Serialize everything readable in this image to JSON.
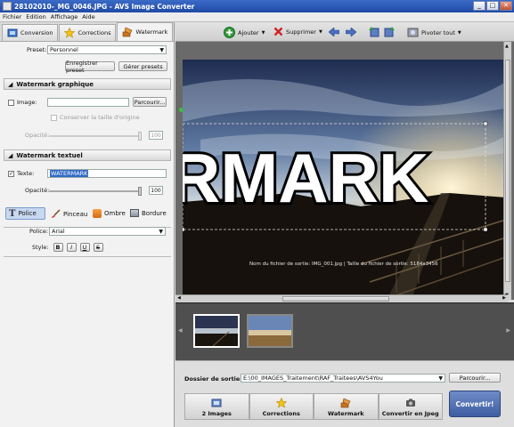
{
  "window": {
    "title": "28102010-_MG_0046.JPG - AVS Image Converter",
    "controls": [
      "_",
      "□",
      "✕"
    ]
  },
  "menu": [
    "Fichier",
    "Edition",
    "Affichage",
    "Aide"
  ],
  "tabs": [
    {
      "label": "Conversion",
      "icon": "conversion-icon"
    },
    {
      "label": "Corrections",
      "icon": "star-icon"
    },
    {
      "label": "Watermark",
      "icon": "watermark-icon",
      "active": true
    }
  ],
  "preset": {
    "label": "Preset:",
    "value": "Personnel"
  },
  "preset_buttons": {
    "save": "Enregistrer preset",
    "manage": "Gérer presets"
  },
  "watermark_graphic": {
    "title": "Watermark graphique",
    "image_label": "Image:",
    "browse": "Parcourir...",
    "keep_size": "Conserver la taille d'origine",
    "opacity_label": "Opacité:",
    "opacity_value": "100",
    "opacity_level": 1.0
  },
  "watermark_text": {
    "title": "Watermark textuel",
    "text_label": "Texte:",
    "text_value": "WATERMARK",
    "opacity_label": "Opacité:",
    "opacity_value": "100",
    "opacity_level": 1.0,
    "subtabs": [
      "Police",
      "Pinceau",
      "Ombre",
      "Bordure"
    ],
    "font_label": "Police:",
    "font_value": "Arial",
    "style_label": "Style:",
    "style_buttons": [
      "B",
      "I",
      "U",
      "S"
    ]
  },
  "toolbar": {
    "add": "Ajouter",
    "delete": "Supprimer",
    "rotate_all": "Pivoter tout"
  },
  "viewer": {
    "overlay_text": "RMARK",
    "file_info": "Nom du fichier de sortie: IMG_001.jpg | Taille du fichier de sortie: 5184x3456"
  },
  "output": {
    "label": "Dossier de sortie:",
    "path": "E:\\00_IMAGES_Traitement\\RAF_Traitees\\AVS4You",
    "browse": "Parcourir..."
  },
  "steps": [
    "2 Images",
    "Corrections",
    "Watermark",
    "Convertir en Jpeg"
  ],
  "convert_button": "Convertir!",
  "colors": {
    "title_blue": "#1f4aa6",
    "convert_blue": "#3e5ea3",
    "selection_blue": "#316ac5"
  }
}
